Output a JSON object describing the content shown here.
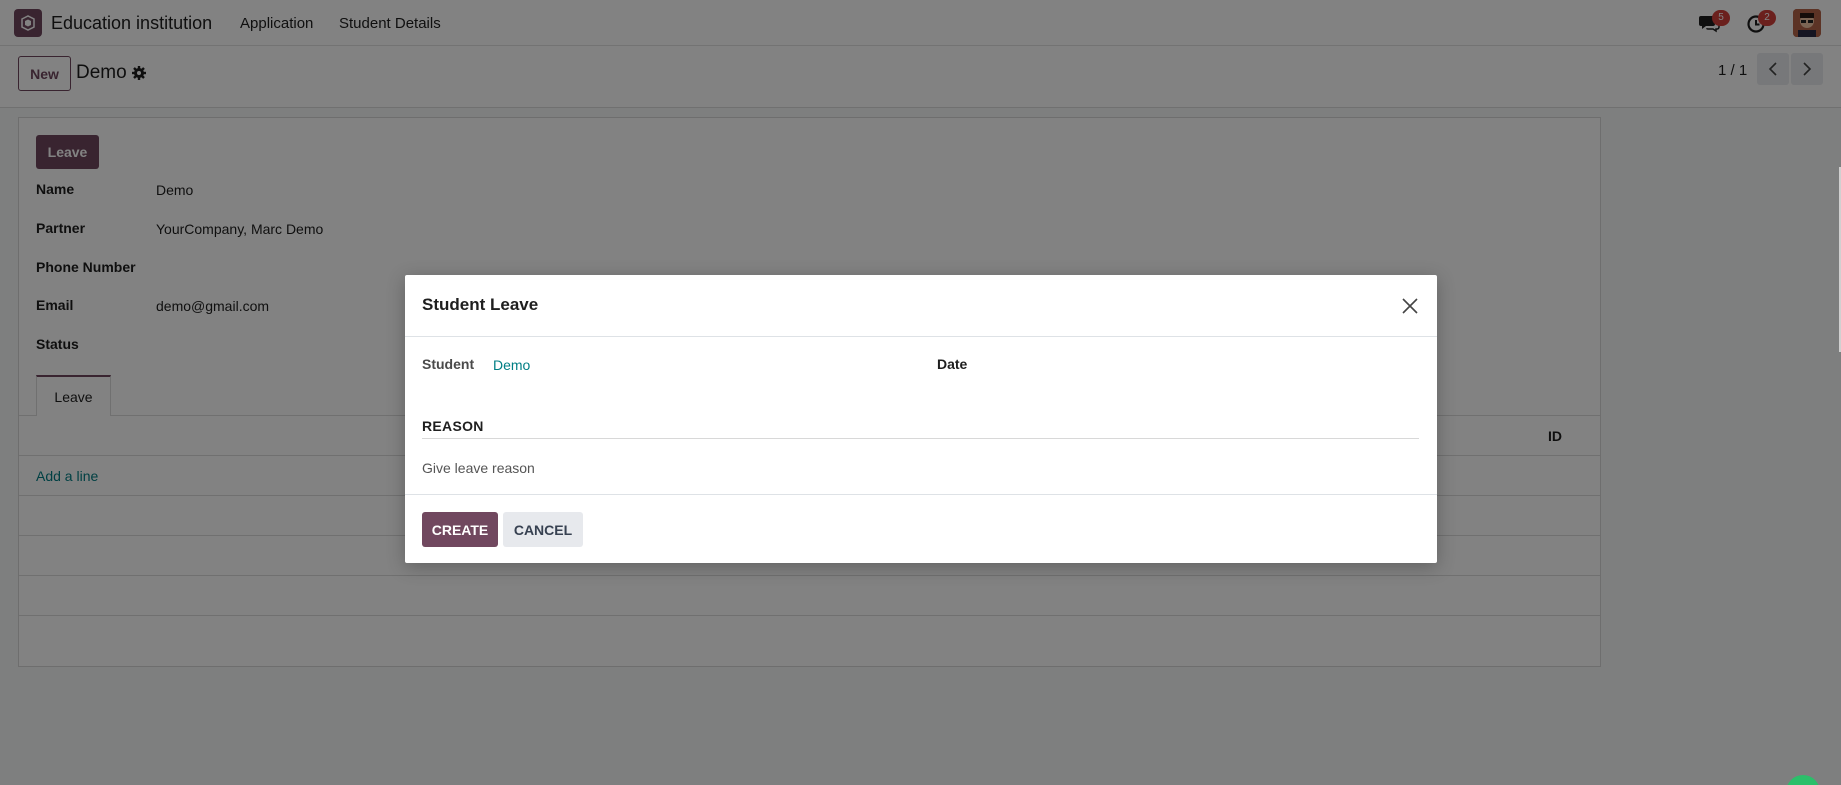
{
  "navbar": {
    "app_name": "Education institution",
    "menu": [
      "Application",
      "Student Details"
    ],
    "messages_count": "5",
    "activities_count": "2"
  },
  "control_panel": {
    "new_label": "New",
    "record_title": "Demo",
    "pager": "1 / 1"
  },
  "form": {
    "leave_button": "Leave",
    "fields": [
      {
        "label": "Name",
        "value": "Demo"
      },
      {
        "label": "Partner",
        "value": "YourCompany, Marc Demo"
      },
      {
        "label": "Phone Number",
        "value": ""
      },
      {
        "label": "Email",
        "value": "demo@gmail.com"
      },
      {
        "label": "Status",
        "value": ""
      }
    ],
    "tab_label": "Leave",
    "table_column": "ID",
    "add_line": "Add a line"
  },
  "modal": {
    "title": "Student Leave",
    "student_label": "Student",
    "student_value": "Demo",
    "date_label": "Date",
    "reason_section": "REASON",
    "reason_placeholder": "Give leave reason",
    "create_label": "CREATE",
    "cancel_label": "CANCEL"
  },
  "colors": {
    "brand": "#71485f",
    "link": "#017e84",
    "badge": "#d23f3a"
  }
}
